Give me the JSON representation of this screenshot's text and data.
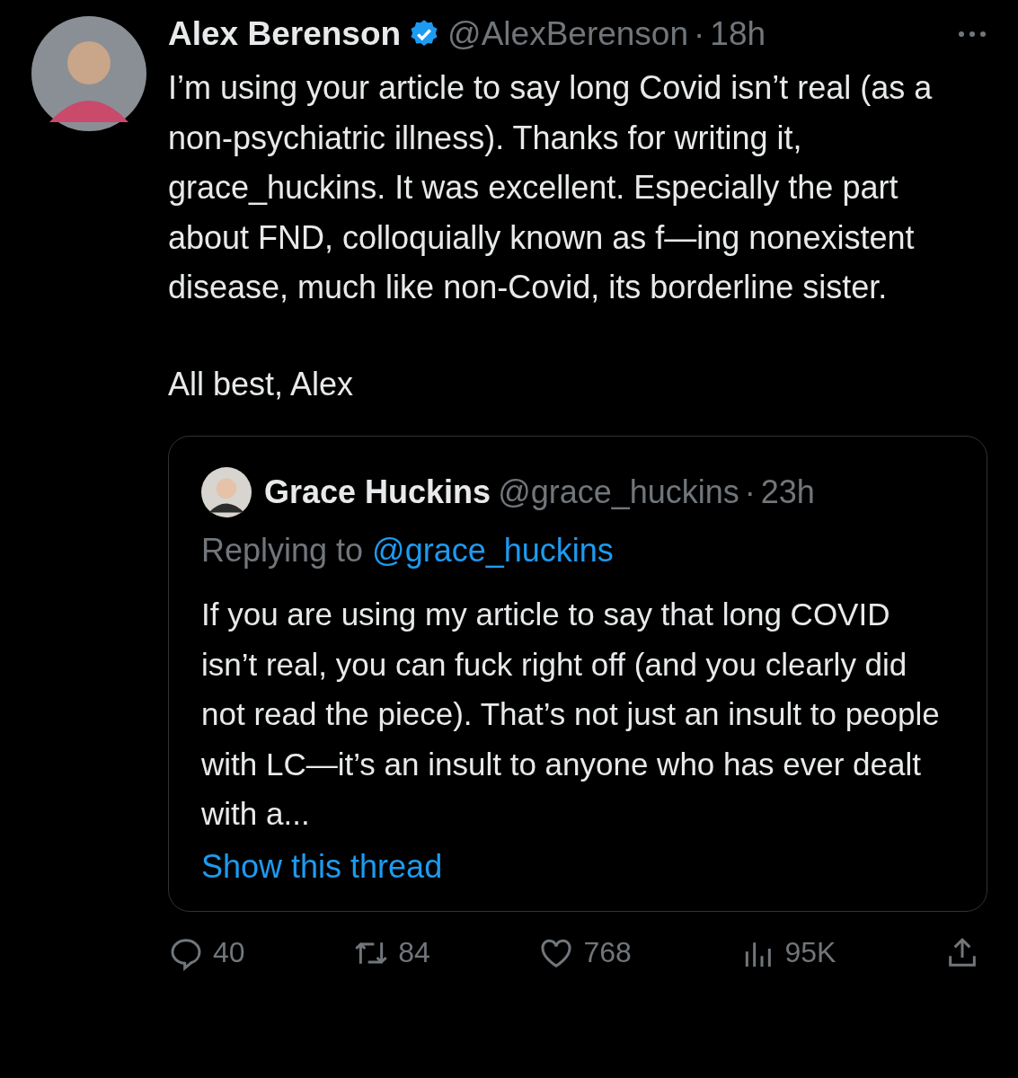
{
  "tweet": {
    "author": {
      "name": "Alex Berenson",
      "verified": true,
      "handle": "@AlexBerenson",
      "separator": "·",
      "time": "18h"
    },
    "paragraphs": [
      "I’m using your article to say long Covid isn’t real (as a non-psychiatric illness). Thanks for writing it, grace_huckins. It was excellent. Especially the part about FND, colloquially known as f—ing nonexistent disease, much like non-Covid, its borderline sister.",
      "All best, Alex"
    ],
    "quote": {
      "author": {
        "name": "Grace Huckins",
        "handle": "@grace_huckins",
        "separator": "·",
        "time": "23h"
      },
      "replying_label": "Replying to",
      "replying_handle": "@grace_huckins",
      "text": "If you are using my article to say that long COVID isn’t real, you can fuck right off (and you clearly did not read the piece). That’s not just an insult to people with LC—it’s an insult to anyone who has ever dealt with a...",
      "show_thread": "Show this thread"
    },
    "actions": [
      {
        "kind": "reply",
        "count": "40"
      },
      {
        "kind": "repost",
        "count": "84"
      },
      {
        "kind": "like",
        "count": "768"
      },
      {
        "kind": "views",
        "count": "95K"
      },
      {
        "kind": "share"
      }
    ]
  }
}
